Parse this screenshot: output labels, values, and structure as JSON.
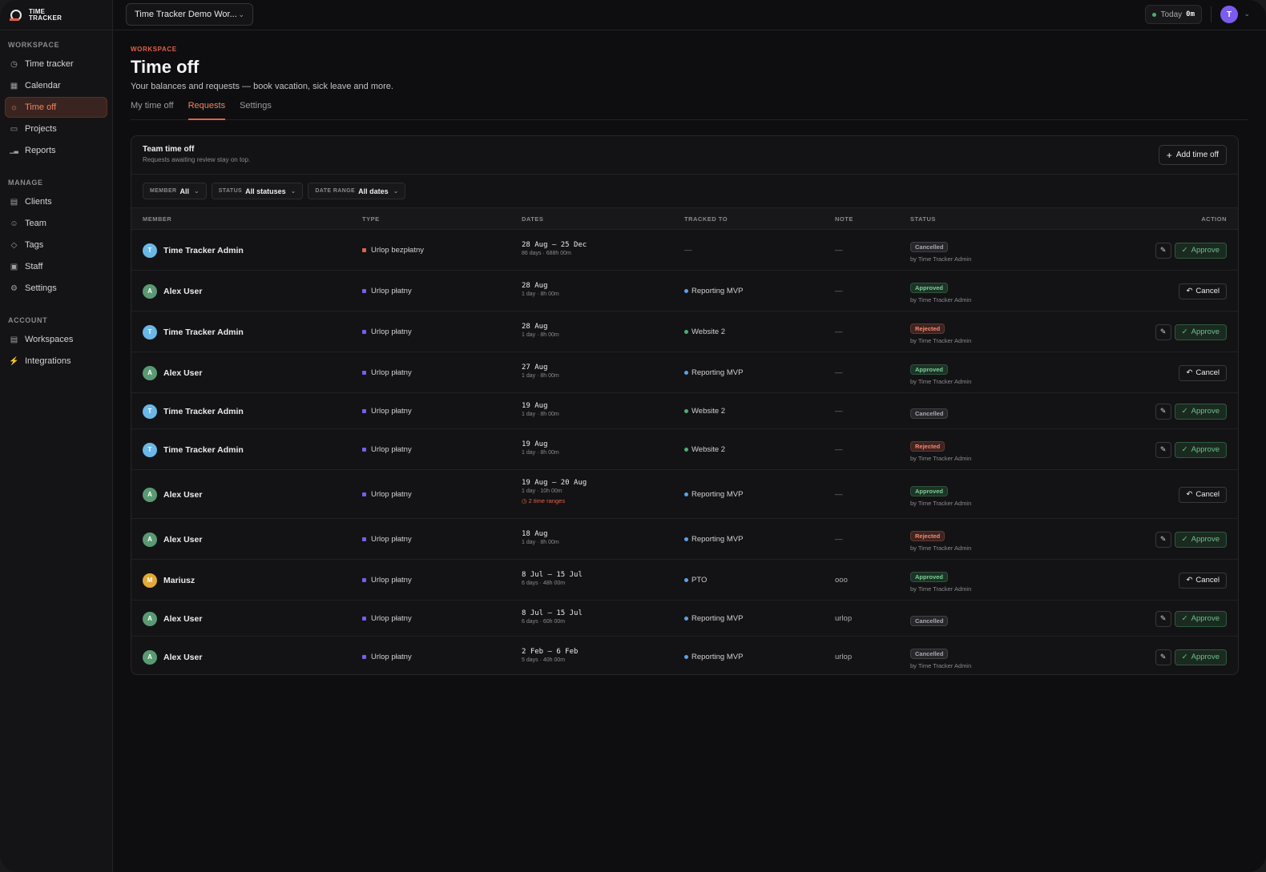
{
  "colors": {
    "accent": "#e0624a",
    "av_t": "#6ab7e8",
    "av_a": "#5a9a72",
    "av_m": "#e0a93a",
    "type_unpaid": "#e0624a",
    "type_paid": "#7b5cf0",
    "proj_reporting": "#5aa2e8",
    "proj_website": "#4caf6e",
    "proj_pto": "#5aa2e8",
    "badge_cancelled_bg": "#27272b",
    "badge_cancelled_fg": "#a8a8ae",
    "badge_approved_bg": "#1c3326",
    "badge_approved_fg": "#7ccf95",
    "badge_rejected_bg": "#3f2320",
    "badge_rejected_fg": "#f08a6f"
  },
  "logo": {
    "line1": "TIME",
    "line2": "TRACKER"
  },
  "sidebar": {
    "sections": [
      {
        "label": "WORKSPACE",
        "items": [
          {
            "label": "Time tracker",
            "icon": "timer-icon"
          },
          {
            "label": "Calendar",
            "icon": "calendar-icon"
          },
          {
            "label": "Time off",
            "icon": "sun-icon",
            "active": true
          },
          {
            "label": "Projects",
            "icon": "folder-icon"
          },
          {
            "label": "Reports",
            "icon": "bar-chart-icon"
          }
        ]
      },
      {
        "label": "MANAGE",
        "items": [
          {
            "label": "Clients",
            "icon": "building-icon"
          },
          {
            "label": "Team",
            "icon": "users-icon"
          },
          {
            "label": "Tags",
            "icon": "tag-icon"
          },
          {
            "label": "Staff",
            "icon": "wallet-icon"
          },
          {
            "label": "Settings",
            "icon": "gear-icon"
          }
        ]
      },
      {
        "label": "ACCOUNT",
        "items": [
          {
            "label": "Workspaces",
            "icon": "workspace-icon"
          },
          {
            "label": "Integrations",
            "icon": "plug-icon"
          }
        ]
      }
    ]
  },
  "topbar": {
    "workspace": "Time Tracker Demo Wor...",
    "today_label": "Today",
    "today_value": "0m",
    "avatar_letter": "T"
  },
  "page": {
    "eyebrow": "WORKSPACE",
    "title": "Time off",
    "subtitle": "Your balances and requests — book vacation, sick leave and more.",
    "tabs": [
      {
        "label": "My time off"
      },
      {
        "label": "Requests",
        "active": true
      },
      {
        "label": "Settings"
      }
    ]
  },
  "card": {
    "title": "Team time off",
    "subtitle": "Requests awaiting review stay on top.",
    "add_button": "Add time off",
    "filters": [
      {
        "label": "MEMBER",
        "value": "All"
      },
      {
        "label": "STATUS",
        "value": "All statuses"
      },
      {
        "label": "DATE RANGE",
        "value": "All dates"
      }
    ],
    "columns": [
      "MEMBER",
      "TYPE",
      "DATES",
      "TRACKED TO",
      "NOTE",
      "STATUS",
      "ACTION"
    ]
  },
  "rows": [
    {
      "member": "Time Tracker Admin",
      "initial": "T",
      "av": "t",
      "type": "Urlop bezpłatny",
      "type_color": "unpaid",
      "dates": "28 Aug – 25 Dec",
      "detail": "86 days · 688h 00m",
      "extra": "",
      "tracked": "—",
      "tracked_color": "",
      "note": "—",
      "status": "Cancelled",
      "by": "by Time Tracker Admin",
      "action": "approve"
    },
    {
      "member": "Alex User",
      "initial": "A",
      "av": "a",
      "type": "Urlop płatny",
      "type_color": "paid",
      "dates": "28 Aug",
      "detail": "1 day · 8h 00m",
      "extra": "",
      "tracked": "Reporting MVP",
      "tracked_color": "reporting",
      "note": "—",
      "status": "Approved",
      "by": "by Time Tracker Admin",
      "action": "cancel"
    },
    {
      "member": "Time Tracker Admin",
      "initial": "T",
      "av": "t",
      "type": "Urlop płatny",
      "type_color": "paid",
      "dates": "28 Aug",
      "detail": "1 day · 8h 00m",
      "extra": "",
      "tracked": "Website 2",
      "tracked_color": "website",
      "note": "—",
      "status": "Rejected",
      "by": "by Time Tracker Admin",
      "action": "approve"
    },
    {
      "member": "Alex User",
      "initial": "A",
      "av": "a",
      "type": "Urlop płatny",
      "type_color": "paid",
      "dates": "27 Aug",
      "detail": "1 day · 8h 00m",
      "extra": "",
      "tracked": "Reporting MVP",
      "tracked_color": "reporting",
      "note": "—",
      "status": "Approved",
      "by": "by Time Tracker Admin",
      "action": "cancel"
    },
    {
      "member": "Time Tracker Admin",
      "initial": "T",
      "av": "t",
      "type": "Urlop płatny",
      "type_color": "paid",
      "dates": "19 Aug",
      "detail": "1 day · 8h 00m",
      "extra": "",
      "tracked": "Website 2",
      "tracked_color": "website",
      "note": "—",
      "status": "Cancelled",
      "by": "",
      "action": "approve"
    },
    {
      "member": "Time Tracker Admin",
      "initial": "T",
      "av": "t",
      "type": "Urlop płatny",
      "type_color": "paid",
      "dates": "19 Aug",
      "detail": "1 day · 8h 00m",
      "extra": "",
      "tracked": "Website 2",
      "tracked_color": "website",
      "note": "—",
      "status": "Rejected",
      "by": "by Time Tracker Admin",
      "action": "approve"
    },
    {
      "member": "Alex User",
      "initial": "A",
      "av": "a",
      "type": "Urlop płatny",
      "type_color": "paid",
      "dates": "19 Aug – 20 Aug",
      "detail": "1 day · 10h 00m",
      "extra": "2 time ranges",
      "tracked": "Reporting MVP",
      "tracked_color": "reporting",
      "note": "—",
      "status": "Approved",
      "by": "by Time Tracker Admin",
      "action": "cancel"
    },
    {
      "member": "Alex User",
      "initial": "A",
      "av": "a",
      "type": "Urlop płatny",
      "type_color": "paid",
      "dates": "18 Aug",
      "detail": "1 day · 8h 00m",
      "extra": "",
      "tracked": "Reporting MVP",
      "tracked_color": "reporting",
      "note": "—",
      "status": "Rejected",
      "by": "by Time Tracker Admin",
      "action": "approve"
    },
    {
      "member": "Mariusz",
      "initial": "M",
      "av": "m",
      "type": "Urlop płatny",
      "type_color": "paid",
      "dates": "8 Jul – 15 Jul",
      "detail": "6 days · 48h 00m",
      "extra": "",
      "tracked": "PTO",
      "tracked_color": "pto",
      "note": "ooo",
      "status": "Approved",
      "by": "by Time Tracker Admin",
      "action": "cancel"
    },
    {
      "member": "Alex User",
      "initial": "A",
      "av": "a",
      "type": "Urlop płatny",
      "type_color": "paid",
      "dates": "8 Jul – 15 Jul",
      "detail": "6 days · 60h 00m",
      "extra": "",
      "tracked": "Reporting MVP",
      "tracked_color": "reporting",
      "note": "urlop",
      "status": "Cancelled",
      "by": "",
      "action": "approve"
    },
    {
      "member": "Alex User",
      "initial": "A",
      "av": "a",
      "type": "Urlop płatny",
      "type_color": "paid",
      "dates": "2 Feb – 6 Feb",
      "detail": "5 days · 40h 00m",
      "extra": "",
      "tracked": "Reporting MVP",
      "tracked_color": "reporting",
      "note": "urlop",
      "status": "Cancelled",
      "by": "by Time Tracker Admin",
      "action": "approve"
    }
  ],
  "labels": {
    "approve": "Approve",
    "cancel": "Cancel"
  }
}
